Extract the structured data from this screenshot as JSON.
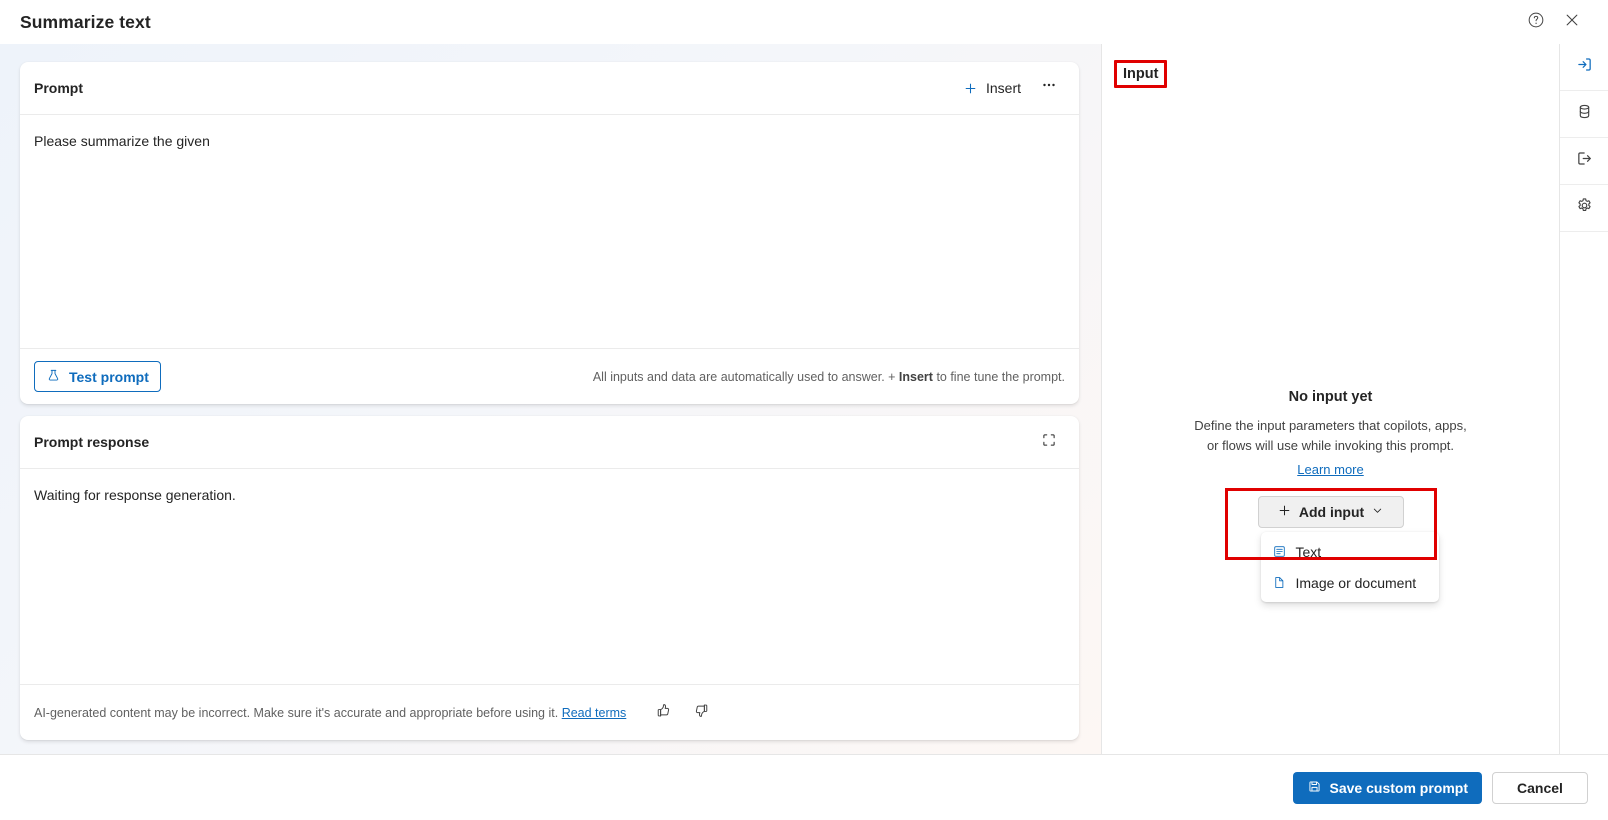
{
  "window": {
    "title": "Summarize text",
    "help_icon": "help-circle-icon",
    "close_icon": "close-icon"
  },
  "prompt_card": {
    "title": "Prompt",
    "insert_label": "Insert",
    "insert_icon": "plus-icon",
    "more_icon": "more-horizontal-icon",
    "text": "Please summarize the given",
    "test_button_label": "Test prompt",
    "test_button_icon": "beaker-icon",
    "hint_prefix": "All inputs and data are automatically used to answer. + ",
    "hint_bold": "Insert",
    "hint_suffix": " to fine tune the prompt."
  },
  "response_card": {
    "title": "Prompt response",
    "expand_icon": "expand-icon",
    "text": "Waiting for response generation.",
    "disclaimer": "AI-generated content may be incorrect. Make sure it's accurate and appropriate before using it. ",
    "disclaimer_link": "Read terms",
    "thumbs_up_icon": "thumbs-up-icon",
    "thumbs_down_icon": "thumbs-down-icon"
  },
  "input_panel": {
    "label": "Input",
    "empty_title": "No input yet",
    "empty_desc_line1": "Define the input parameters that copilots, apps,",
    "empty_desc_line2": "or flows will use while invoking this prompt.",
    "learn_more": "Learn more",
    "add_input_label": "Add input",
    "add_input_icon": "plus-icon",
    "add_input_chevron": "chevron-down-icon",
    "menu": [
      {
        "label": "Text",
        "icon": "text-list-icon"
      },
      {
        "label": "Image or document",
        "icon": "document-icon"
      }
    ]
  },
  "right_rail": [
    {
      "name": "input",
      "icon": "arrow-into-box-icon",
      "active": true
    },
    {
      "name": "data",
      "icon": "database-icon",
      "active": false
    },
    {
      "name": "output",
      "icon": "arrow-out-of-box-icon",
      "active": false
    },
    {
      "name": "settings",
      "icon": "gear-icon",
      "active": false
    }
  ],
  "footer": {
    "save_label": "Save custom prompt",
    "save_icon": "save-icon",
    "cancel_label": "Cancel"
  },
  "colors": {
    "accent": "#0f6cbd",
    "annotation": "#e00000",
    "text": "#242424",
    "muted": "#616161"
  }
}
